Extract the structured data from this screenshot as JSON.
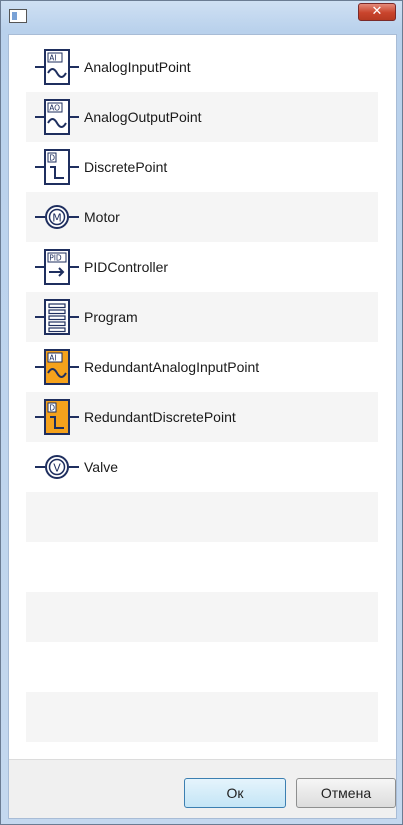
{
  "window": {
    "close_glyph": "✕"
  },
  "items": [
    {
      "label": "AnalogInputPoint",
      "icon": "analog-input-icon",
      "tag": "AI",
      "orange": false
    },
    {
      "label": "AnalogOutputPoint",
      "icon": "analog-output-icon",
      "tag": "AO",
      "orange": false
    },
    {
      "label": "DiscretePoint",
      "icon": "discrete-point-icon",
      "tag": "D",
      "orange": false
    },
    {
      "label": "Motor",
      "icon": "motor-icon",
      "tag": "M",
      "orange": false
    },
    {
      "label": "PIDController",
      "icon": "pid-controller-icon",
      "tag": "PID",
      "orange": false
    },
    {
      "label": "Program",
      "icon": "program-icon",
      "tag": "",
      "orange": false
    },
    {
      "label": "RedundantAnalogInputPoint",
      "icon": "redundant-analog-input-icon",
      "tag": "AI",
      "orange": true
    },
    {
      "label": "RedundantDiscretePoint",
      "icon": "redundant-discrete-point-icon",
      "tag": "D",
      "orange": true
    },
    {
      "label": "Valve",
      "icon": "valve-icon",
      "tag": "V",
      "orange": false
    }
  ],
  "footer": {
    "ok_label": "Ок",
    "cancel_label": "Отмена"
  },
  "colors": {
    "icon_stroke": "#1f2f5f",
    "icon_orange": "#f5a21c",
    "accent": "#3c7fb1"
  }
}
